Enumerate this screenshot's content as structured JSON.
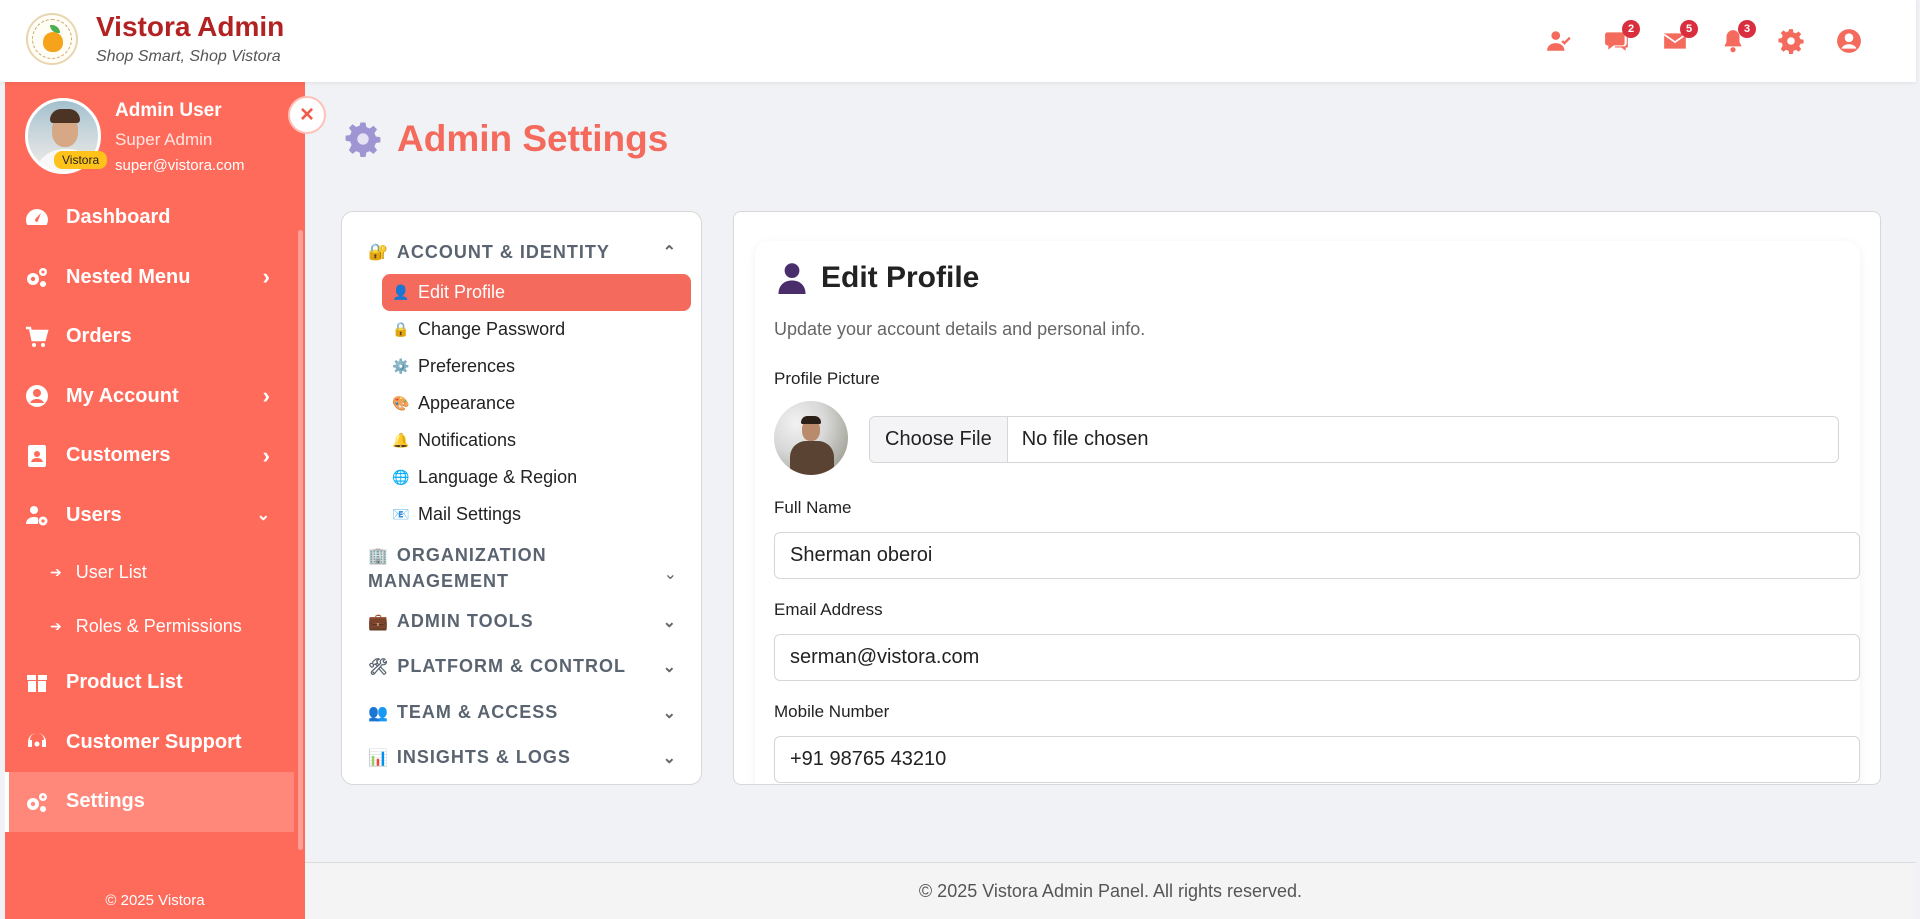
{
  "header": {
    "title": "Vistora Admin",
    "tagline": "Shop Smart, Shop Vistora",
    "icons": [
      {
        "name": "user-check-icon",
        "badge": ""
      },
      {
        "name": "chat-icon",
        "badge": "2"
      },
      {
        "name": "mail-icon",
        "badge": "5"
      },
      {
        "name": "bell-icon",
        "badge": "3"
      },
      {
        "name": "gear-icon",
        "badge": ""
      },
      {
        "name": "user-circle-icon",
        "badge": ""
      }
    ],
    "accent": "#f46a5c"
  },
  "sidebar": {
    "user_name": "Admin User",
    "user_role": "Super Admin",
    "user_email": "super@vistora.com",
    "avatar_badge": "Vistora",
    "close_symbol": "×",
    "items": [
      {
        "label": "Dashboard",
        "icon": "gauge-icon"
      },
      {
        "label": "Nested Menu",
        "icon": "cogs-icon"
      },
      {
        "label": "Orders",
        "icon": "cart-icon"
      },
      {
        "label": "My Account",
        "icon": "user-circle-icon"
      },
      {
        "label": "Customers",
        "icon": "address-card-icon"
      },
      {
        "label": "Users",
        "icon": "users-cog-icon"
      },
      {
        "label": "Product List",
        "icon": "box-icon"
      },
      {
        "label": "Customer Support",
        "icon": "headset-icon"
      },
      {
        "label": "Settings",
        "icon": "cogs-icon"
      }
    ],
    "subitems": [
      {
        "label": "User List"
      },
      {
        "label": "Roles & Permissions"
      }
    ],
    "copyright": "© 2025 Vistora",
    "bg_color": "#ff6b5b"
  },
  "page": {
    "title": "Admin Settings"
  },
  "settings_nav": {
    "sections": [
      {
        "label": "ACCOUNT & IDENTITY",
        "icon": "lock-key-icon",
        "expanded": true
      },
      {
        "label": "ORGANIZATION MANAGEMENT",
        "icon": "building-icon",
        "expanded": false
      },
      {
        "label": "ADMIN TOOLS",
        "icon": "briefcase-icon",
        "expanded": false
      },
      {
        "label": "PLATFORM & CONTROL",
        "icon": "tools-icon",
        "expanded": false
      },
      {
        "label": "TEAM & ACCESS",
        "icon": "team-icon",
        "expanded": false
      },
      {
        "label": "INSIGHTS & LOGS",
        "icon": "bar-chart-icon",
        "expanded": false
      }
    ],
    "account_items": [
      {
        "label": "Edit Profile",
        "icon": "user-icon"
      },
      {
        "label": "Change Password",
        "icon": "lock-icon"
      },
      {
        "label": "Preferences",
        "icon": "gear-icon"
      },
      {
        "label": "Appearance",
        "icon": "palette-icon"
      },
      {
        "label": "Notifications",
        "icon": "bell-icon"
      },
      {
        "label": "Language & Region",
        "icon": "globe-icon"
      },
      {
        "label": "Mail Settings",
        "icon": "mail-icon"
      }
    ]
  },
  "profile_form": {
    "title": "Edit Profile",
    "description": "Update your account details and personal info.",
    "picture_label": "Profile Picture",
    "choose_file": "Choose File",
    "no_file": "No file chosen",
    "full_name_label": "Full Name",
    "full_name": "Sherman oberoi",
    "email_label": "Email Address",
    "email": "serman@vistora.com",
    "mobile_label": "Mobile Number",
    "mobile": "+91 98765 43210"
  },
  "footer": {
    "text": "© 2025 Vistora Admin Panel. All rights reserved."
  }
}
